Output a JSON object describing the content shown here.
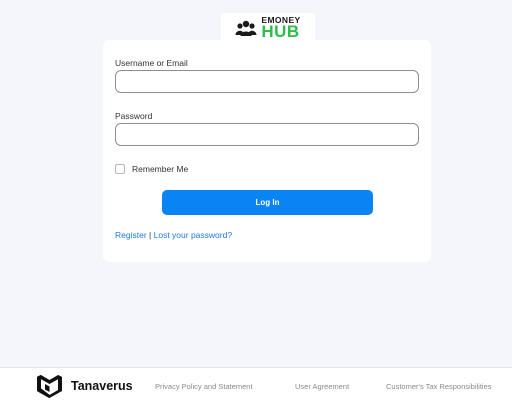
{
  "logo": {
    "line1": "EMONEY",
    "line2": "HUB"
  },
  "form": {
    "username_label": "Username or Email",
    "username_value": "",
    "password_label": "Password",
    "password_value": "",
    "remember_label": "Remember Me",
    "remember_checked": false,
    "login_label": "Log In",
    "register_link": "Register",
    "separator": "|",
    "lost_password_link": "Lost your password?"
  },
  "footer": {
    "brand": "Tanaverus",
    "links": [
      "Privacy Policy and Statement",
      "User Agreement",
      "Customer's Tax Responsibilities"
    ]
  },
  "colors": {
    "background": "#f4f6fb",
    "primary_button": "#0a84f2",
    "link": "#1f7ae0",
    "logo_green": "#2dbd4a"
  }
}
